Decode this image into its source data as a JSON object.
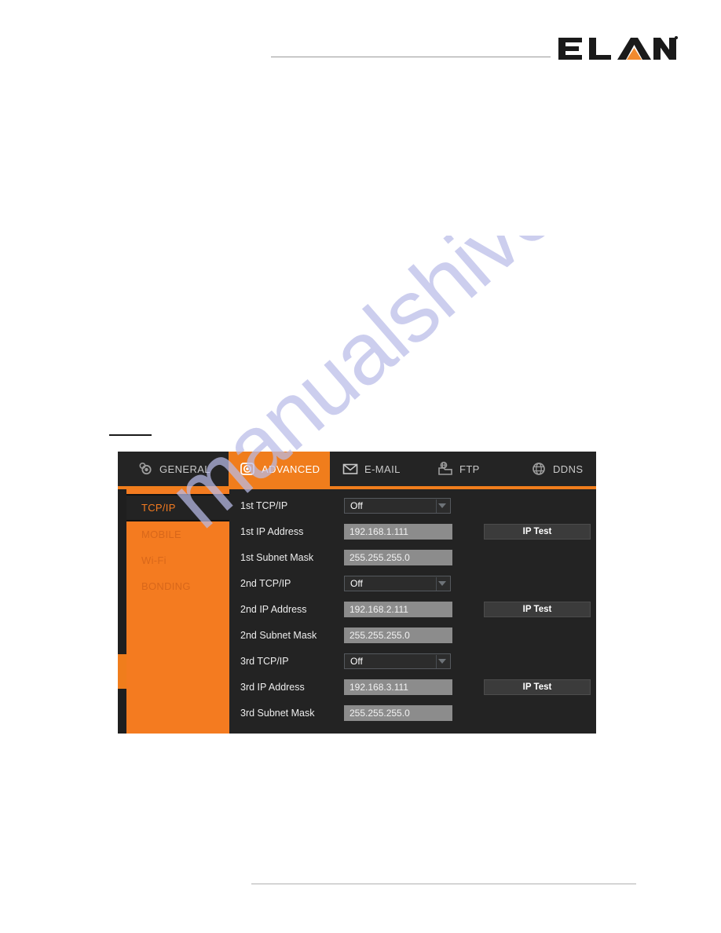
{
  "brand": {
    "name": "ELAN",
    "trademark": "®",
    "logo_icon": "elan-logo",
    "accent_color": "#F47B20",
    "text_color": "#1A1A1A"
  },
  "device_ui": {
    "accent_color": "#F47B20",
    "background_color": "#1F1F1F",
    "panel_color": "#232323",
    "tabs": [
      {
        "label": "GENERAL",
        "icon": "camera-gear-icon",
        "active": false
      },
      {
        "label": "ADVANCED",
        "icon": "dome-camera-icon",
        "active": true
      },
      {
        "label": "E-MAIL",
        "icon": "envelope-icon",
        "active": false
      },
      {
        "label": "FTP",
        "icon": "folder-globe-icon",
        "active": false
      },
      {
        "label": "DDNS",
        "icon": "globe-icon",
        "active": false
      }
    ],
    "sidebar": {
      "items": [
        {
          "label": "TCP/IP",
          "active": true
        },
        {
          "label": "MOBILE",
          "active": false
        },
        {
          "label": "Wi-Fi",
          "active": false
        },
        {
          "label": "BONDING",
          "active": false
        }
      ]
    },
    "form": {
      "rows": [
        {
          "label": "1st TCP/IP",
          "type": "select",
          "value": "Off"
        },
        {
          "label": "1st IP Address",
          "type": "text",
          "value": "192.168.1.111",
          "button": "IP Test"
        },
        {
          "label": "1st Subnet Mask",
          "type": "text",
          "value": "255.255.255.0"
        },
        {
          "label": "2nd TCP/IP",
          "type": "select",
          "value": "Off"
        },
        {
          "label": "2nd IP Address",
          "type": "text",
          "value": "192.168.2.111",
          "button": "IP Test"
        },
        {
          "label": "2nd Subnet Mask",
          "type": "text",
          "value": "255.255.255.0"
        },
        {
          "label": "3rd TCP/IP",
          "type": "select",
          "value": "Off"
        },
        {
          "label": "3rd IP Address",
          "type": "text",
          "value": "192.168.3.111",
          "button": "IP Test"
        },
        {
          "label": "3rd Subnet Mask",
          "type": "text",
          "value": "255.255.255.0"
        }
      ]
    }
  },
  "watermark": {
    "text": "manualshive.com",
    "color": "#B9BCE8"
  }
}
